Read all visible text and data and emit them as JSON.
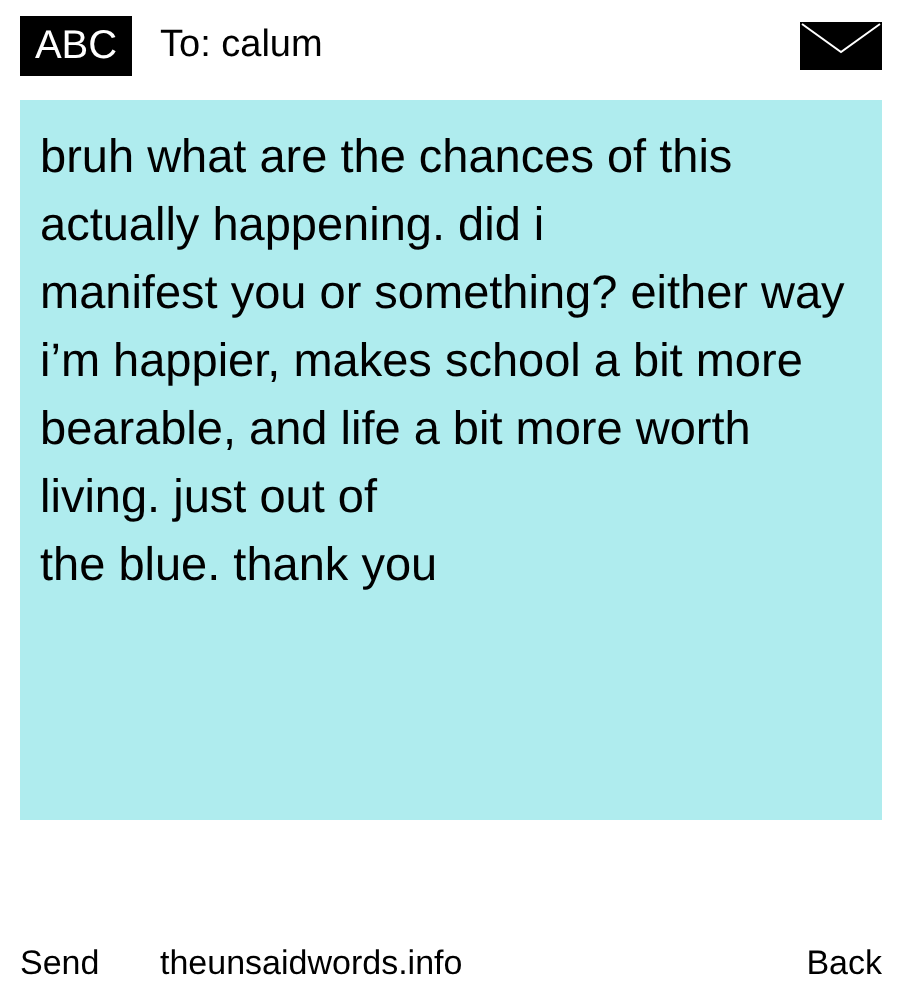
{
  "header": {
    "input_mode": "ABC",
    "recipient": "To: calum"
  },
  "message": {
    "value": "bruh what are the chances of this actually happening. did i\nmanifest you or something? either way i’m happier, makes school a bit more bearable, and life a bit more worth living. just out of\nthe blue. thank you"
  },
  "softkeys": {
    "left": "Send",
    "middle": "theunsaidwords.info",
    "right": "Back"
  }
}
